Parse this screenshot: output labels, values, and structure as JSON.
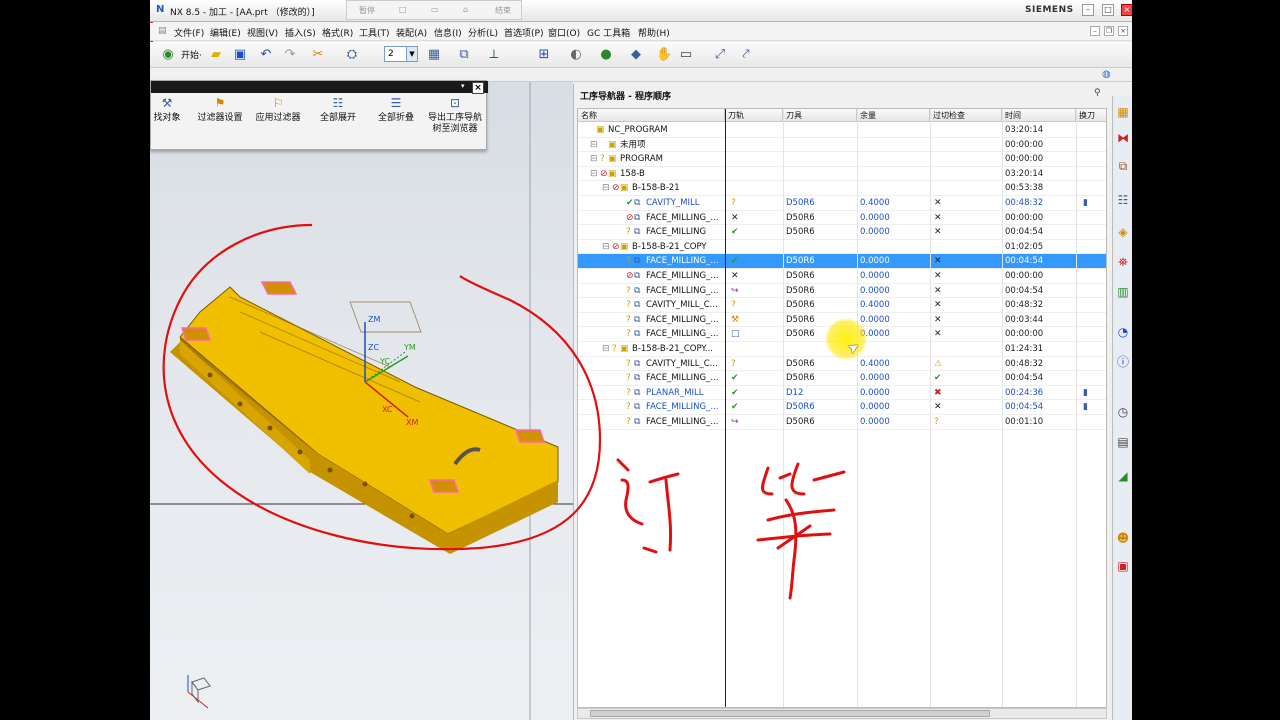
{
  "app": {
    "title": "NX 8.5 - 加工 - [AA.prt （修改的）]",
    "brand": "SIEMENS",
    "recorder": [
      "暂停",
      "结束"
    ]
  },
  "menu": [
    "文件(F)",
    "编辑(E)",
    "视图(V)",
    "插入(S)",
    "格式(R)",
    "工具(T)",
    "装配(A)",
    "信息(I)",
    "分析(L)",
    "首选项(P)",
    "窗口(O)",
    "GC 工具箱",
    "帮助(H)"
  ],
  "toolbar": {
    "start_label": "开始·",
    "layer_value": "2"
  },
  "nav_toolbar": {
    "items": [
      {
        "label": "找对象",
        "icon": "find-object-icon"
      },
      {
        "label": "过滤器设置",
        "icon": "filter-settings-icon"
      },
      {
        "label": "应用过滤器",
        "icon": "apply-filter-icon"
      },
      {
        "label": "全部展开",
        "icon": "expand-all-icon"
      },
      {
        "label": "全部折叠",
        "icon": "collapse-all-icon"
      },
      {
        "label": "导出工序导航树至浏览器",
        "icon": "export-browser-icon"
      }
    ]
  },
  "navigator": {
    "title": "工序导航器 - 程序顺序",
    "columns": [
      "名称",
      "刀轨",
      "刀具",
      "余量",
      "过切检查",
      "时间",
      "换刀"
    ],
    "rows": [
      {
        "name": "NC_PROGRAM",
        "level": 0,
        "tool": "",
        "stock": "",
        "time": "03:20:14"
      },
      {
        "name": "未用项",
        "level": 1,
        "tool": "",
        "stock": "",
        "time": "00:00:00"
      },
      {
        "name": "PROGRAM",
        "level": 1,
        "tool": "",
        "stock": "",
        "time": "00:00:00"
      },
      {
        "name": "158-B",
        "level": 1,
        "tool": "",
        "stock": "",
        "time": "03:20:14"
      },
      {
        "name": "B-158-B-21",
        "level": 2,
        "tool": "",
        "stock": "",
        "time": "00:53:38"
      },
      {
        "name": "CAVITY_MILL",
        "level": 3,
        "tool": "D50R6",
        "stock": "0.4000",
        "time": "00:48:32"
      },
      {
        "name": "FACE_MILLING_...",
        "level": 3,
        "tool": "D50R6",
        "stock": "0.0000",
        "time": "00:00:00"
      },
      {
        "name": "FACE_MILLING",
        "level": 3,
        "tool": "D50R6",
        "stock": "0.0000",
        "time": "00:04:54"
      },
      {
        "name": "B-158-B-21_COPY",
        "level": 2,
        "tool": "",
        "stock": "",
        "time": "01:02:05"
      },
      {
        "name": "FACE_MILLING_...",
        "level": 3,
        "tool": "D50R6",
        "stock": "0.0000",
        "time": "00:04:54"
      },
      {
        "name": "FACE_MILLING_...",
        "level": 3,
        "tool": "D50R6",
        "stock": "0.0000",
        "time": "00:00:00"
      },
      {
        "name": "FACE_MILLING_...",
        "level": 3,
        "tool": "D50R6",
        "stock": "0.0000",
        "time": "00:04:54"
      },
      {
        "name": "CAVITY_MILL_C...",
        "level": 3,
        "tool": "D50R6",
        "stock": "0.4000",
        "time": "00:48:32"
      },
      {
        "name": "FACE_MILLING_...",
        "level": 3,
        "tool": "D50R6",
        "stock": "0.0000",
        "time": "00:03:44"
      },
      {
        "name": "FACE_MILLING_...",
        "level": 3,
        "tool": "D50R6",
        "stock": "0.0000",
        "time": "00:00:00"
      },
      {
        "name": "B-158-B-21_COPY...",
        "level": 2,
        "tool": "",
        "stock": "",
        "time": "01:24:31"
      },
      {
        "name": "CAVITY_MILL_C...",
        "level": 3,
        "tool": "D50R6",
        "stock": "0.4000",
        "time": "00:48:32"
      },
      {
        "name": "FACE_MILLING_...",
        "level": 3,
        "tool": "D50R6",
        "stock": "0.0000",
        "time": "00:04:54"
      },
      {
        "name": "PLANAR_MILL",
        "level": 3,
        "tool": "D12",
        "stock": "0.0000",
        "time": "00:24:36"
      },
      {
        "name": "FACE_MILLING_...",
        "level": 3,
        "tool": "D50R6",
        "stock": "0.0000",
        "time": "00:04:54"
      },
      {
        "name": "FACE_MILLING_...",
        "level": 3,
        "tool": "D50R6",
        "stock": "0.0000",
        "time": "00:01:10"
      }
    ]
  },
  "viewport": {
    "axis_labels": [
      "ZM",
      "ZC",
      "YM",
      "YC",
      "XC",
      "XM"
    ]
  },
  "colors": {
    "selection": "#3399ff",
    "ink": "#e01010",
    "part": "#e8b400",
    "link": "#1a4ec8"
  }
}
